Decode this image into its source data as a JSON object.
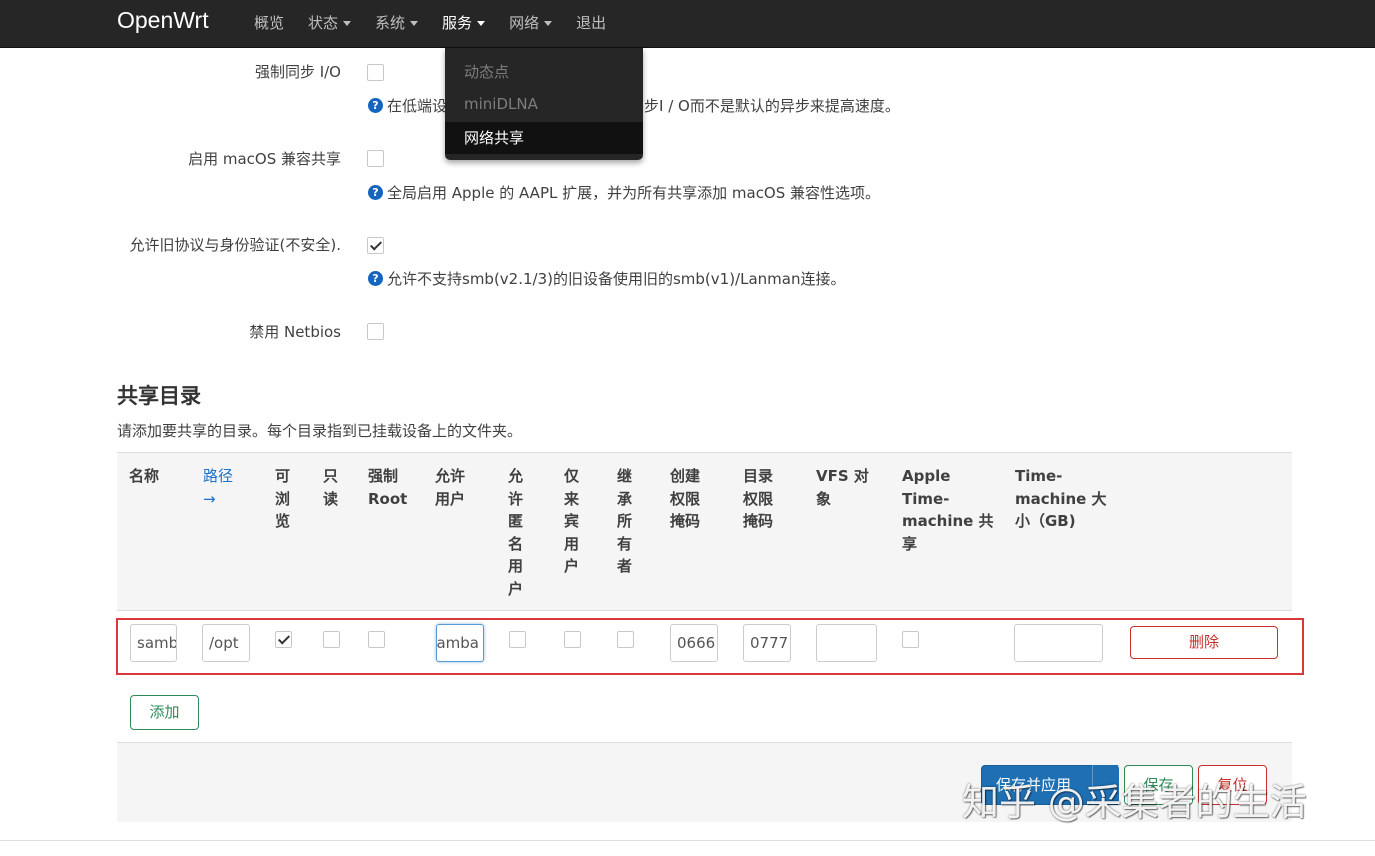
{
  "navbar": {
    "brand": "OpenWrt",
    "items": [
      {
        "label": "概览",
        "dropdown": false
      },
      {
        "label": "状态",
        "dropdown": true
      },
      {
        "label": "系统",
        "dropdown": true
      },
      {
        "label": "服务",
        "dropdown": true
      },
      {
        "label": "网络",
        "dropdown": true
      },
      {
        "label": "退出",
        "dropdown": false
      }
    ],
    "open_menu": {
      "items": [
        "动态点",
        "miniDLNA",
        "网络共享"
      ],
      "active": "网络共享"
    }
  },
  "settings": {
    "sync_io": {
      "label": "强制同步 I/O",
      "checked": false,
      "help_start": "在低端设",
      "help_end": "同步I / O而不是默认的异步来提高速度。"
    },
    "macos": {
      "label": "启用 macOS 兼容共享",
      "checked": false,
      "help": "全局启用 Apple 的 AAPL 扩展，并为所有共享添加 macOS 兼容性选项。"
    },
    "legacy": {
      "label": "允许旧协议与身份验证(不安全).",
      "checked": true,
      "help": "允许不支持smb(v2.1/3)的旧设备使用旧的smb(v1)/Lanman连接。"
    },
    "netbios": {
      "label": "禁用 Netbios",
      "checked": false
    }
  },
  "shares": {
    "title": "共享目录",
    "description": "请添加要共享的目录。每个目录指到已挂载设备上的文件夹。",
    "columns": {
      "name": "名称",
      "path": "路径",
      "path_arrow": "→",
      "browseable": "可浏览",
      "read_only": "只读",
      "force_root": "强制 Root",
      "allowed_users": "允许用户",
      "guest_ok": "允许匿名用户",
      "guest_only": "仅来宾用户",
      "inherit_owner": "继承所有者",
      "create_mask": "创建权限掩码",
      "dir_mask": "目录权限掩码",
      "vfs": "VFS 对象",
      "timemachine": "Apple Time-machine 共享",
      "tm_size": "Time-machine 大小（GB)"
    },
    "row": {
      "name": "samba",
      "path": "/opt",
      "browseable": true,
      "read_only": false,
      "force_root": false,
      "allowed_users": "samba",
      "guest_ok": false,
      "guest_only": false,
      "inherit_owner": false,
      "create_mask": "0666",
      "dir_mask": "0777",
      "vfs": "",
      "timemachine": false,
      "tm_size": ""
    },
    "delete_label": "删除",
    "add_label": "添加"
  },
  "actions": {
    "apply_label": "保存并应用",
    "save_label": "保存",
    "reset_label": "复位"
  },
  "watermark": "知乎 @采集者的生活"
}
